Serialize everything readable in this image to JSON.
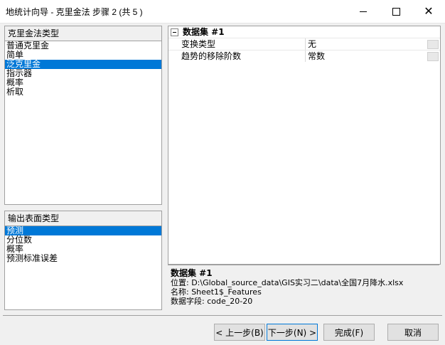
{
  "window": {
    "title": "地统计向导 - 克里金法 步骤 2 (共 5 )",
    "minimize": "—",
    "maximize": "□",
    "close": "✕"
  },
  "kriging_types": {
    "header": "克里金法类型",
    "items": [
      {
        "label": "普通克里金",
        "selected": false
      },
      {
        "label": "简单",
        "selected": false
      },
      {
        "label": "泛克里金",
        "selected": true
      },
      {
        "label": "指示器",
        "selected": false
      },
      {
        "label": "概率",
        "selected": false
      },
      {
        "label": "析取",
        "selected": false
      }
    ]
  },
  "output_types": {
    "header": "输出表面类型",
    "items": [
      {
        "label": "预测",
        "selected": true
      },
      {
        "label": "分位数",
        "selected": false
      },
      {
        "label": "概率",
        "selected": false
      },
      {
        "label": "预测标准误差",
        "selected": false
      }
    ]
  },
  "properties": {
    "group_label": "数据集 #1",
    "rows": [
      {
        "name": "变换类型",
        "value": "无"
      },
      {
        "name": "趋势的移除阶数",
        "value": "常数"
      }
    ]
  },
  "info": {
    "title": "数据集 #1",
    "location": "位置: D:\\Global_source_data\\GIS实习二\\data\\全国7月降水.xlsx",
    "name": "名称: Sheet1$_Features",
    "field": "数据字段: code_20-20"
  },
  "buttons": {
    "back": "< 上一步(B)",
    "next": "下一步(N) >",
    "finish": "完成(F)",
    "cancel": "取消"
  }
}
